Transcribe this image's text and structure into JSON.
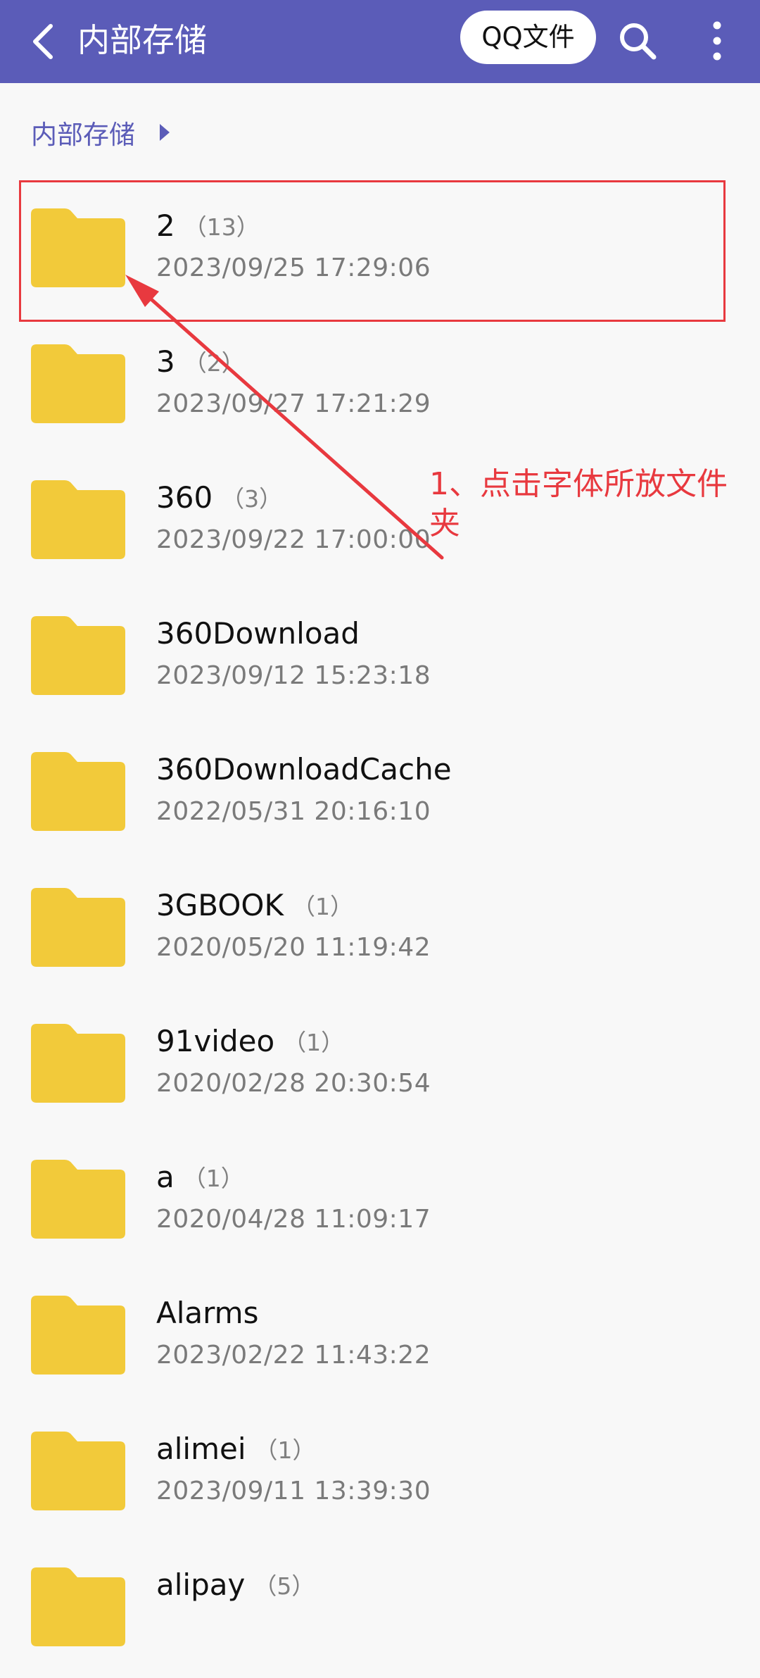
{
  "appbar": {
    "title": "内部存储",
    "qq_button": "QQ文件",
    "color": "#5b5cb8"
  },
  "breadcrumb": {
    "label": "内部存储"
  },
  "folders": [
    {
      "name": "2",
      "count": "（13）",
      "date": "2023/09/25 17:29:06"
    },
    {
      "name": "3",
      "count": "（2）",
      "date": "2023/09/27 17:21:29"
    },
    {
      "name": "360",
      "count": "（3）",
      "date": "2023/09/22 17:00:00"
    },
    {
      "name": "360Download",
      "count": "",
      "date": "2023/09/12 15:23:18"
    },
    {
      "name": "360DownloadCache",
      "count": "",
      "date": "2022/05/31 20:16:10"
    },
    {
      "name": "3GBOOK",
      "count": "（1）",
      "date": "2020/05/20 11:19:42"
    },
    {
      "name": "91video",
      "count": "（1）",
      "date": "2020/02/28 20:30:54"
    },
    {
      "name": "a",
      "count": "（1）",
      "date": "2020/04/28 11:09:17"
    },
    {
      "name": "Alarms",
      "count": "",
      "date": "2023/02/22 11:43:22"
    },
    {
      "name": "alimei",
      "count": "（1）",
      "date": "2023/09/11 13:39:30"
    },
    {
      "name": "alipay",
      "count": "（5）",
      "date": ""
    }
  ],
  "annotation": {
    "text": "1、点击字体所放文件夹",
    "color": "#e8393f"
  },
  "icons": {
    "back": "back-arrow-icon",
    "search": "search-icon",
    "more": "more-vertical-icon",
    "folder": "folder-icon",
    "breadcrumb_arrow": "triangle-right-icon"
  },
  "folder_color": "#f2ca3a"
}
